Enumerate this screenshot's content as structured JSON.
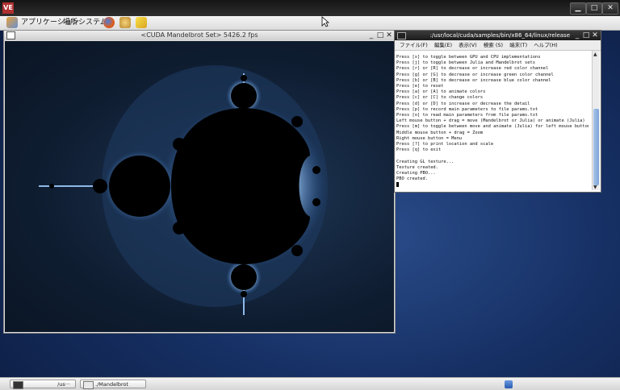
{
  "vnc": {
    "logo": "VE",
    "controls": [
      "▁",
      "□",
      "✕"
    ]
  },
  "panel": {
    "menus": [
      "アプリケーション",
      "場所",
      "システム"
    ]
  },
  "mandelbrot_window": {
    "title": "<CUDA Mandelbrot Set> 5426.2 fps",
    "controls": [
      "_",
      "□",
      "✕"
    ]
  },
  "terminal": {
    "title": ":/usr/local/cuda/samples/bin/x86_64/linux/release",
    "controls": [
      "_",
      "□",
      "✕"
    ],
    "menus": [
      "ファイル(F)",
      "編集(E)",
      "表示(V)",
      "検索 (S)",
      "端末(T)",
      "ヘルプ(H)"
    ],
    "lines": [
      "Press [s] to toggle between GPU and CPU implementations",
      "Press [j] to toggle between Julia and Mandelbrot sets",
      "Press [r] or [R] to decrease or increase red color channel",
      "Press [g] or [G] to decrease or increase green color channel",
      "Press [b] or [B] to decrease or increase blue color channel",
      "Press [e] to reset",
      "Press [a] or [A] to animate colors",
      "Press [c] or [C] to change colors",
      "Press [d] or [D] to increase or decrease the detail",
      "Press [p] to record main parameters to file params.txt",
      "Press [o] to read main parameters from file params.txt",
      "Left mouse button + drag = move (Mandelbrot or Julia) or animate (Julia)",
      "Press [m] to toggle between move and animate (Julia) for left mouse button",
      "Middle mouse button + drag = Zoom",
      "Right mouse button = Menu",
      "Press [?] to print location and scale",
      "Press [q] to exit",
      "",
      "Creating GL texture...",
      "Texture created.",
      "Creating PBO...",
      "PBO created."
    ]
  },
  "taskbar": {
    "tasks": [
      "/us···",
      "./Mandelbrot"
    ]
  }
}
